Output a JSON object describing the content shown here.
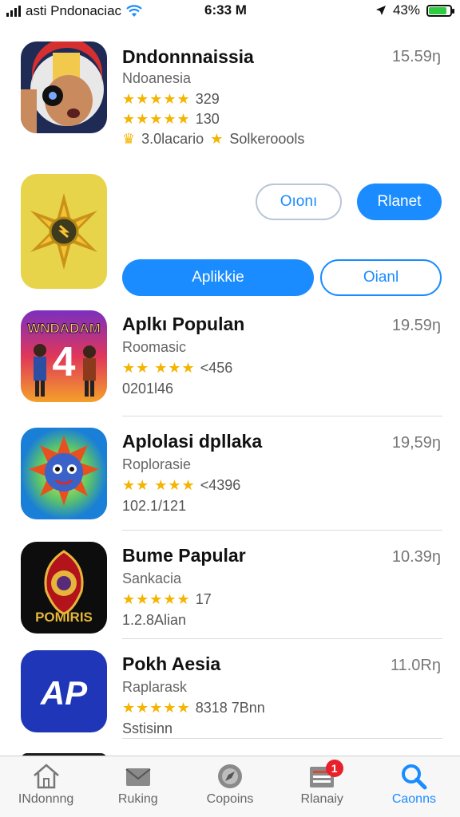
{
  "status_bar": {
    "carrier": "asti Pndonaciac",
    "time": "6:33 M",
    "battery_percent": "43%",
    "battery_level": 0.85
  },
  "apps": [
    {
      "title": "Dndonnnaissia",
      "subtitle": "Ndoanesia",
      "rating1": "329",
      "rating2": "130",
      "meta_a": "3.0lacario",
      "meta_b": "Solkeroools",
      "price": "15.59ŋ",
      "icon": "astronaut-icon"
    },
    {
      "title": "Aplkı Populan",
      "subtitle": "Roomasic",
      "rating": "<456",
      "meta": "0201l46",
      "price": "19.59ŋ",
      "icon": "wndadam-icon",
      "icon_text": "WNDADAM",
      "icon_number": "4"
    },
    {
      "title": "Aplolasi dpllaka",
      "subtitle": "Roplorasie",
      "rating": "<4396",
      "meta": "102.1/121",
      "price": "19,59ŋ",
      "icon": "sun-mask-icon"
    },
    {
      "title": "Bume Papular",
      "subtitle": "Sankacia",
      "rating": "17",
      "meta": "1.2.8Alian",
      "price": "10.39ŋ",
      "icon": "pomiris-icon",
      "icon_text": "POMIRIS"
    },
    {
      "title": "Pokh Aesia",
      "subtitle": "Raplarask",
      "rating": "8318 7Bnn",
      "meta": "Sstisinn",
      "price": "11.0Rŋ",
      "icon": "ap-icon",
      "icon_text": "AP"
    }
  ],
  "promo": {
    "btn_open1": "Oıonı",
    "btn_planet": "Rlanet",
    "btn_apply": "Aplikkie",
    "btn_open2": "Oianl",
    "icon": "golden-star-icon"
  },
  "tabs": [
    {
      "label": "INdonnng",
      "icon": "home-icon"
    },
    {
      "label": "Ruking",
      "icon": "mail-icon"
    },
    {
      "label": "Copoins",
      "icon": "compass-icon"
    },
    {
      "label": "Rlanaiy",
      "icon": "list-icon",
      "badge": "1"
    },
    {
      "label": "Caonns",
      "icon": "search-icon"
    }
  ],
  "colors": {
    "accent": "#1a8cff",
    "star": "#f5b400",
    "badge": "#e8202a",
    "battery": "#2ecc40"
  }
}
